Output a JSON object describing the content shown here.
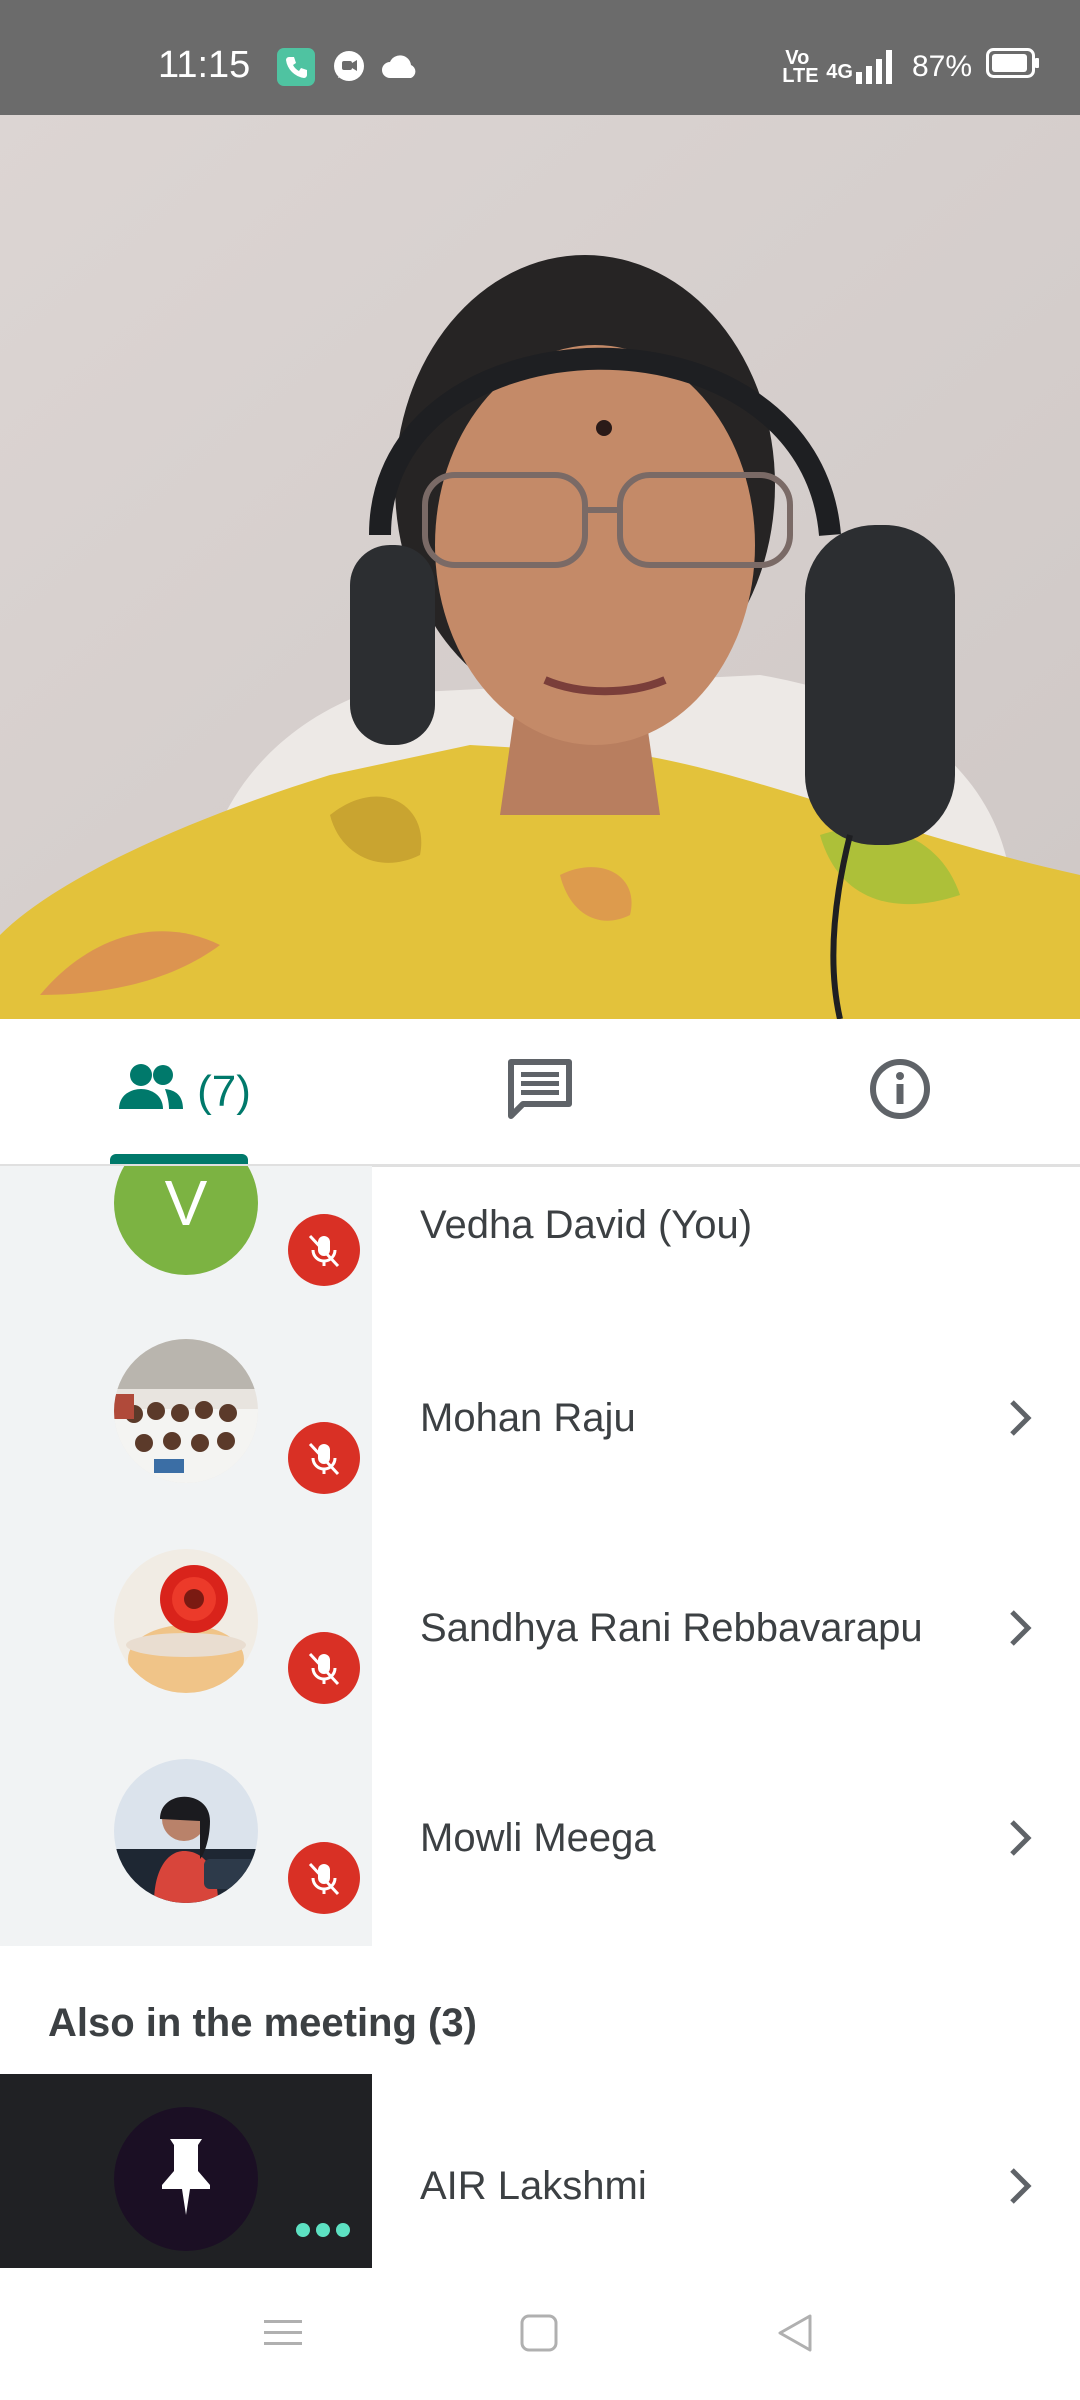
{
  "status_bar": {
    "time": "11:15",
    "icons": [
      "phone-call-icon",
      "chat-bubble-icon",
      "cloud-icon"
    ],
    "network_label": "Vo LTE",
    "signal_label": "4G",
    "battery_percent": "87%"
  },
  "video": {
    "participant": "speaker video feed"
  },
  "tabs": {
    "people_count": "(7)",
    "chat_icon": "chat-icon",
    "info_icon": "info-icon",
    "selected": "people"
  },
  "participants": [
    {
      "name": "Vedha David (You)",
      "initial": "V",
      "avatar_color": "#7cb342",
      "muted": true
    },
    {
      "name": "Mohan Raju",
      "muted": true
    },
    {
      "name": "Sandhya Rani Rebbavarapu",
      "muted": true
    },
    {
      "name": "Mowli Meega",
      "muted": true
    }
  ],
  "also_in_meeting": {
    "title": "Also in the meeting (3)",
    "items": [
      {
        "name": "AIR Lakshmi",
        "icon": "pin-icon"
      }
    ]
  },
  "colors": {
    "accent": "#00796b",
    "mute_red": "#d93025",
    "tile_bg": "#f1f3f4",
    "dark_tile": "#202124"
  },
  "nav_bar": {
    "buttons": [
      "menu-icon",
      "home-icon",
      "back-icon"
    ]
  }
}
